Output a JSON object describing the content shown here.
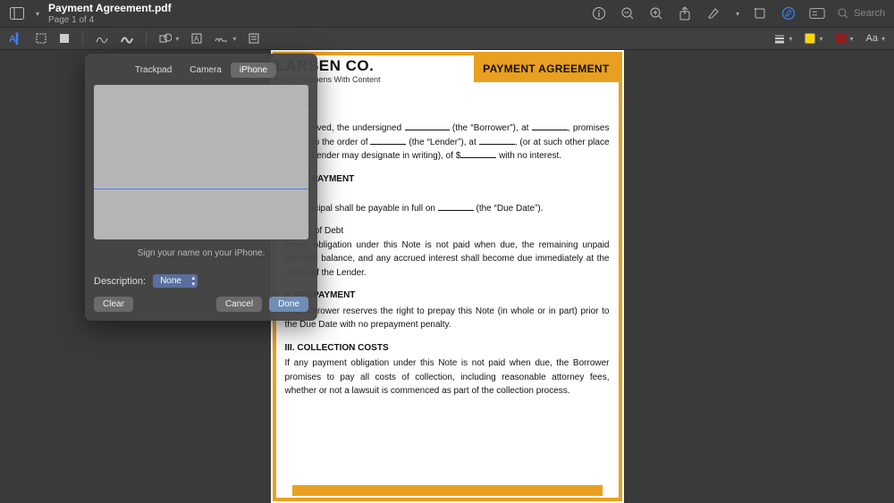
{
  "titlebar": {
    "doc_title": "Payment Agreement.pdf",
    "page_info": "Page 1 of 4",
    "search_placeholder": "Search"
  },
  "markup": {
    "text_style_label": "Aa"
  },
  "signature_panel": {
    "tabs": {
      "trackpad": "Trackpad",
      "camera": "Camera",
      "iphone": "iPhone"
    },
    "caption": "Sign your name on your iPhone.",
    "description_label": "Description:",
    "description_value": "None",
    "clear": "Clear",
    "cancel": "Cancel",
    "done": "Done"
  },
  "document": {
    "company_name": "LARSEN CO.",
    "company_tagline": "Magic Happens With Content",
    "badge": "PAYMENT AGREEMENT",
    "intro_p1_a": "ue received, the undersigned ",
    "intro_p1_b": " (the “Borrower”), at ",
    "intro_p1_c": ", promises to pay to the order of ",
    "intro_p1_d": " (the “Lender”), at ",
    "intro_p1_e": ", (or at such other place as the Lender may designate in writing), ",
    "intro_p1_f": "of $",
    "intro_p1_g": " with no interest.",
    "sec_repay_title": "OF REPAYMENT",
    "sec_repay_sub1": "nts",
    "sec_repay_line1a": "aid principal shall be payable in full on ",
    "sec_repay_line1b": " (the “Due Date”).",
    "sec_accel_sub": "eration of Debt",
    "sec_accel_body": "yment obligation under this Note is not paid when due, the remaining unpaid principal balance, and any accrued interest shall become due immediately at the option of the Lender.",
    "sec2_title": "II. PREPAYMENT",
    "sec2_body": "The Borrower reserves the right to prepay this Note (in whole or in part) prior to the Due Date with no prepayment penalty.",
    "sec3_title": "III. COLLECTION COSTS",
    "sec3_body": "If any payment obligation under this Note is not paid when due, the Borrower promises to pay all costs of collection, including reasonable attorney fees, whether or not a lawsuit is commenced as part of the collection process."
  }
}
